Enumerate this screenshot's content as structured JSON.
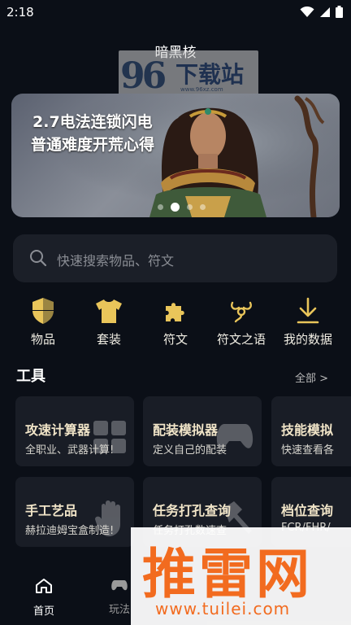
{
  "status": {
    "time": "2:18"
  },
  "app": {
    "title": "暗黑核"
  },
  "watermark_top": {
    "num": "96",
    "text": "下载站",
    "url": "www.96xz.com"
  },
  "banner": {
    "line1": "2.7电法连锁闪电",
    "line2": "普通难度开荒心得",
    "dots": 4,
    "active_dot": 1
  },
  "search": {
    "placeholder": "快速搜索物品、符文"
  },
  "categories": [
    {
      "label": "物品",
      "icon": "shield-icon"
    },
    {
      "label": "套装",
      "icon": "shirt-icon"
    },
    {
      "label": "符文",
      "icon": "puzzle-icon"
    },
    {
      "label": "符文之语",
      "icon": "rune-icon"
    },
    {
      "label": "我的数据",
      "icon": "download-icon"
    }
  ],
  "tools": {
    "title": "工具",
    "all": "全部 >",
    "cards": [
      {
        "title": "攻速计算器",
        "desc": "全职业、武器计算!"
      },
      {
        "title": "配装模拟器",
        "desc": "定义自己的配装"
      },
      {
        "title": "技能模拟",
        "desc": "快速查看各"
      },
      {
        "title": "手工艺品",
        "desc": "赫拉迪姆宝盒制造!"
      },
      {
        "title": "任务打孔查询",
        "desc": "任务打孔数速查"
      },
      {
        "title": "档位查询",
        "desc": "FCR/FHR/"
      }
    ]
  },
  "nav": {
    "home": "首页",
    "play": "玩法"
  },
  "watermark_bottom": {
    "main": "推雷网",
    "url": "www.tuilei.com"
  },
  "colors": {
    "background": "#0b0f17",
    "card": "#191d26",
    "accent_gold": "#e9c55a",
    "watermark_orange": "#f26b1f"
  }
}
